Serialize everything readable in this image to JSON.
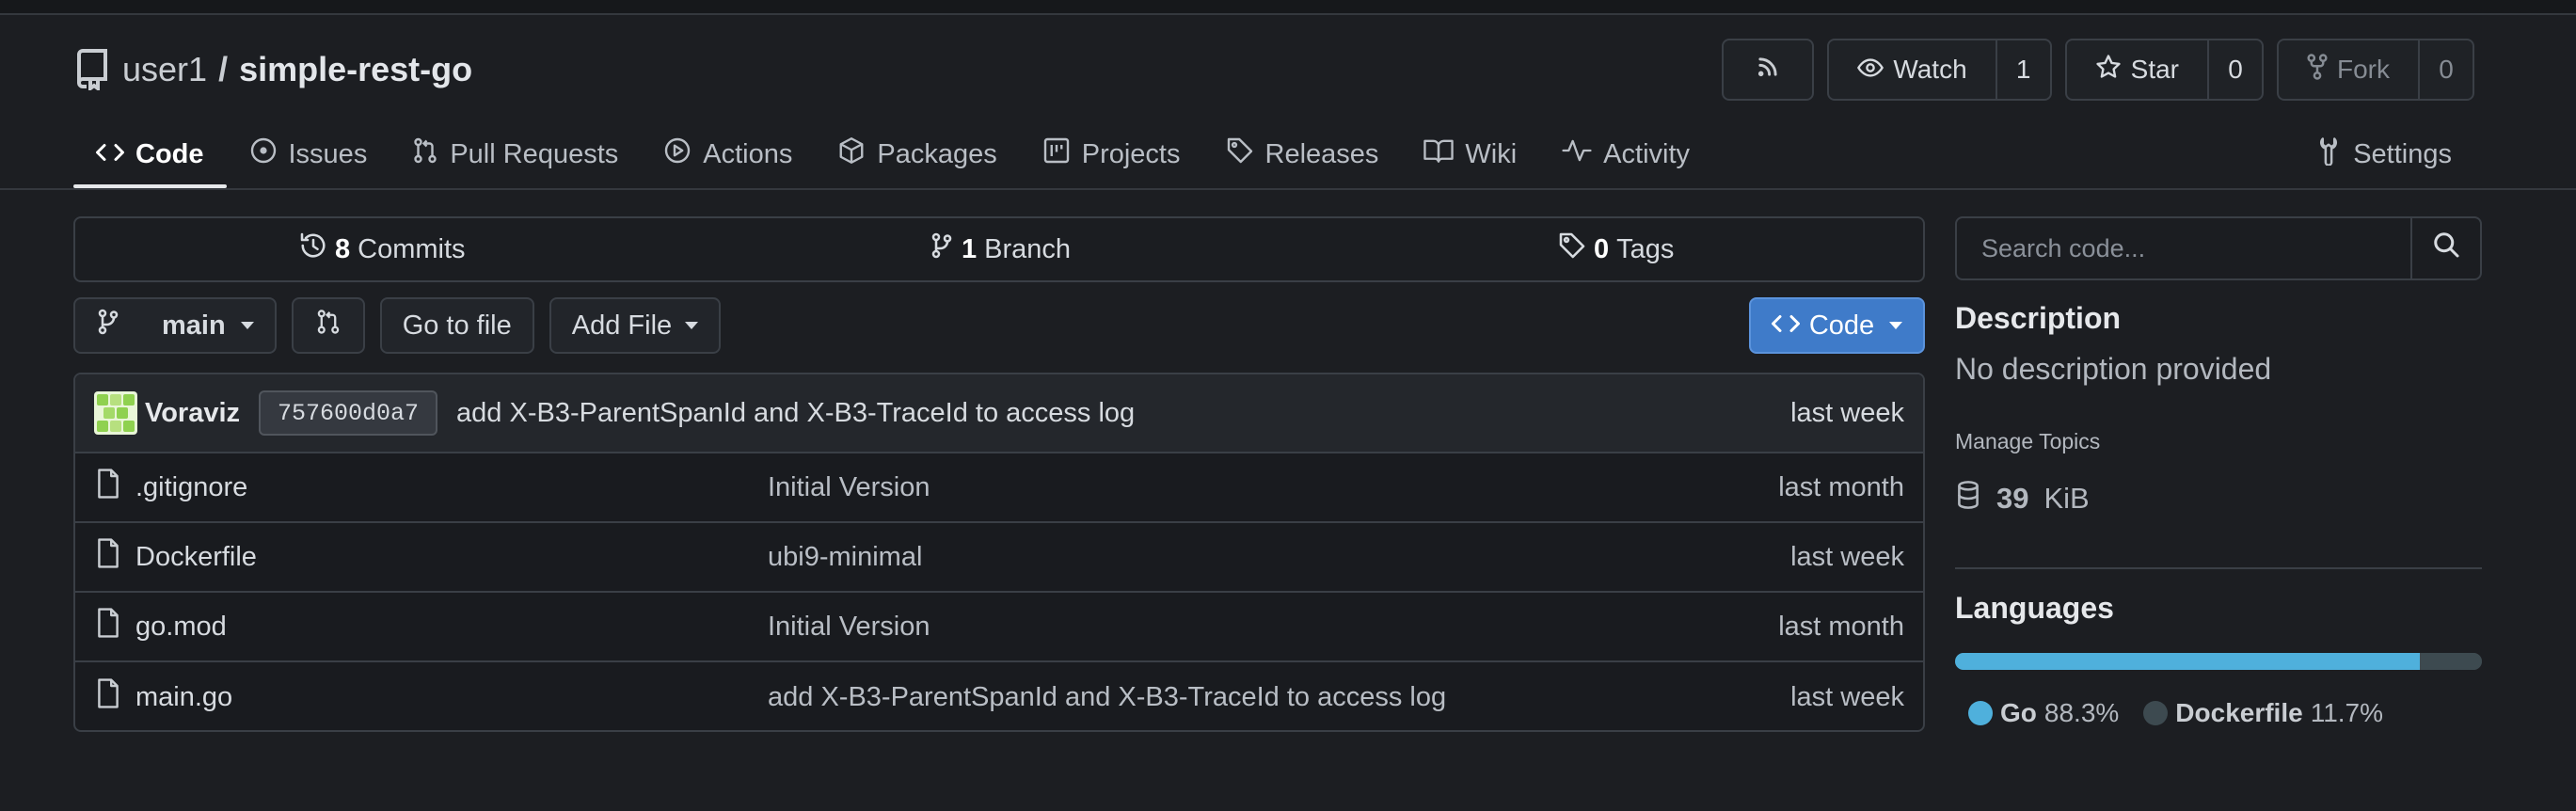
{
  "repo": {
    "owner": "user1",
    "separator": "/",
    "name": "simple-rest-go"
  },
  "header_buttons": {
    "watch": {
      "label": "Watch",
      "count": "1"
    },
    "star": {
      "label": "Star",
      "count": "0"
    },
    "fork": {
      "label": "Fork",
      "count": "0"
    }
  },
  "tabs": [
    {
      "label": "Code",
      "icon": "code-icon"
    },
    {
      "label": "Issues",
      "icon": "issue-icon"
    },
    {
      "label": "Pull Requests",
      "icon": "pull-request-icon"
    },
    {
      "label": "Actions",
      "icon": "play-icon"
    },
    {
      "label": "Packages",
      "icon": "package-icon"
    },
    {
      "label": "Projects",
      "icon": "project-icon"
    },
    {
      "label": "Releases",
      "icon": "tag-icon"
    },
    {
      "label": "Wiki",
      "icon": "book-icon"
    },
    {
      "label": "Activity",
      "icon": "pulse-icon"
    }
  ],
  "settings_tab": {
    "label": "Settings"
  },
  "stats": {
    "commits": {
      "count": "8",
      "label": "Commits"
    },
    "branches": {
      "count": "1",
      "label": "Branch"
    },
    "tags": {
      "count": "0",
      "label": "Tags"
    }
  },
  "toolbar": {
    "branch": "main",
    "go_to_file": "Go to file",
    "add_file": "Add File",
    "code": "Code"
  },
  "latest_commit": {
    "author": "Voraviz",
    "sha": "757600d0a7",
    "message": "add X-B3-ParentSpanId and X-B3-TraceId to access log",
    "time": "last week"
  },
  "files": [
    {
      "name": ".gitignore",
      "message": "Initial Version",
      "time": "last month"
    },
    {
      "name": "Dockerfile",
      "message": "ubi9-minimal",
      "time": "last week"
    },
    {
      "name": "go.mod",
      "message": "Initial Version",
      "time": "last month"
    },
    {
      "name": "main.go",
      "message": "add X-B3-ParentSpanId and X-B3-TraceId to access log",
      "time": "last week"
    }
  ],
  "sidebar": {
    "search_placeholder": "Search code...",
    "description_heading": "Description",
    "description_text": "No description provided",
    "manage_topics": "Manage Topics",
    "size_value": "39",
    "size_unit": "KiB",
    "languages_heading": "Languages",
    "languages": [
      {
        "name": "Go",
        "percent": "88.3%",
        "fraction": 0.883,
        "color": "#4fb0dc"
      },
      {
        "name": "Dockerfile",
        "percent": "11.7%",
        "fraction": 0.117,
        "color": "#3d4a50"
      }
    ]
  },
  "colors": {
    "accent": "#3f7bc9",
    "background": "#1c1e22"
  }
}
